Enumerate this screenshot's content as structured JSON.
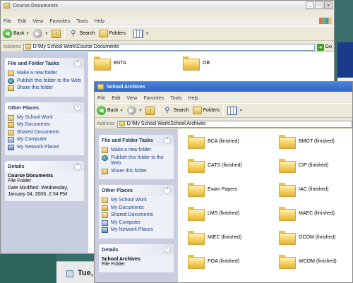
{
  "window_back": {
    "title": "Course Documents",
    "menu": [
      "File",
      "Edit",
      "View",
      "Favorites",
      "Tools",
      "Help"
    ],
    "toolbar": {
      "back": "Back",
      "search": "Search",
      "folders": "Folders"
    },
    "address": {
      "label": "Address",
      "value": "D:\\My School Work\\Course Documents",
      "go": "Go"
    },
    "file_tasks": {
      "title": "File and Folder Tasks",
      "items": [
        "Make a new folder",
        "Publish this folder to the Web",
        "Share this folder"
      ]
    },
    "other_places": {
      "title": "Other Places",
      "items": [
        "My School Work",
        "My Documents",
        "Shared Documents",
        "My Computer",
        "My Network Places"
      ]
    },
    "details": {
      "title": "Details",
      "name": "Course Documents",
      "type": "File Folder",
      "modified": "Date Modified: Wednesday, January 04, 2006, 2:34 PM"
    },
    "folders": [
      "BSTA",
      "OB"
    ]
  },
  "window_front": {
    "title": "School Archives",
    "menu": [
      "File",
      "Edit",
      "View",
      "Favorites",
      "Tools",
      "Help"
    ],
    "toolbar": {
      "back": "Back",
      "search": "Search",
      "folders": "Folders"
    },
    "address": {
      "label": "Address",
      "value": "D:\\My School Work\\School Archives"
    },
    "file_tasks": {
      "title": "File and Folder Tasks",
      "items": [
        "Make a new folder",
        "Publish this folder to the Web",
        "Share this folder"
      ]
    },
    "other_places": {
      "title": "Other Places",
      "items": [
        "My School Work",
        "My Documents",
        "Shared Documents",
        "My Computer",
        "My Network Places"
      ]
    },
    "details": {
      "title": "Details",
      "name": "School Archives",
      "type": "File Folder"
    },
    "folders": [
      "BCA (finished)",
      "BMGT (finished)",
      "CATS (finished)",
      "CIP (finished)",
      "Exam Papers",
      "IAC (finished)",
      "LMS (finished)",
      "MAEC (finished)",
      "MIEC (finished)",
      "OCOM (finished)",
      "POA (finished)",
      "WCOM (finished)"
    ]
  },
  "taskbar": {
    "clock_text": "Tue, F"
  }
}
